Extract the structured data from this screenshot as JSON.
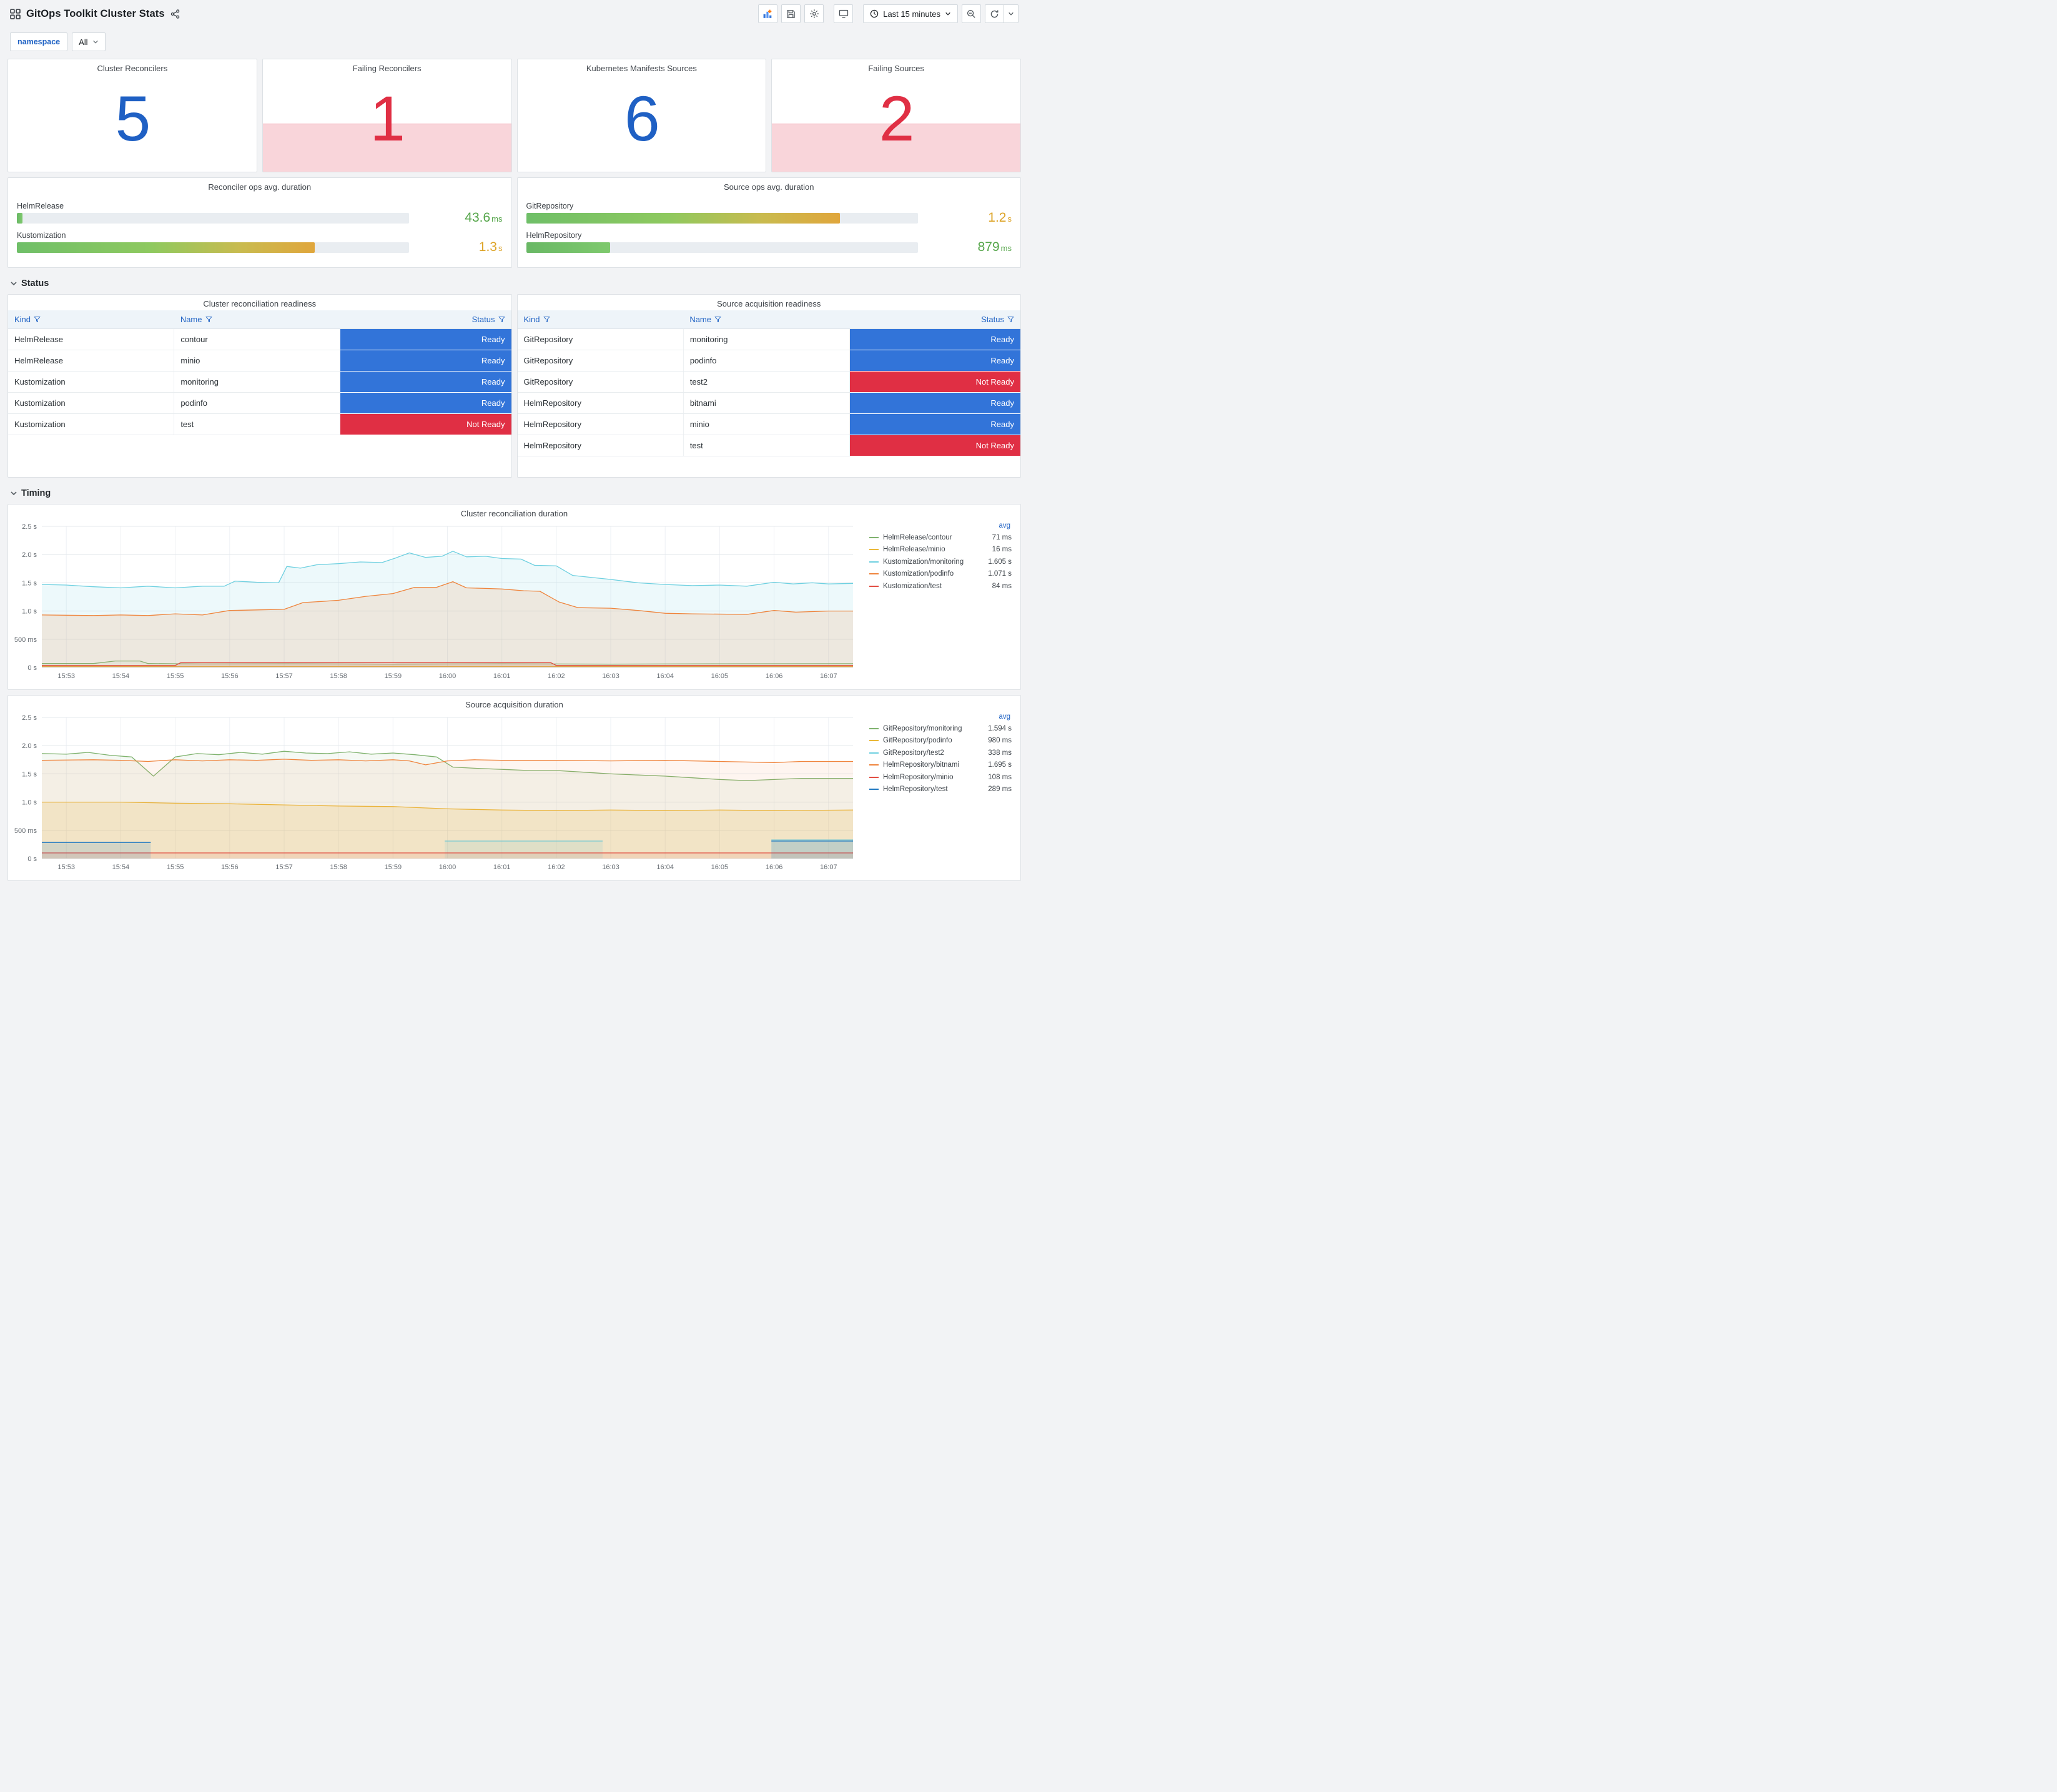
{
  "header": {
    "title": "GitOps Toolkit Cluster Stats",
    "time_range": "Last 15 minutes"
  },
  "variables": {
    "label": "namespace",
    "value": "All"
  },
  "colors": {
    "stat_ok": "#1f60c4",
    "stat_alert": "#e02f44",
    "ready": "#3274d9",
    "not_ready": "#e02f44",
    "value_green": "#56a64b",
    "value_yellow": "#dda428",
    "link_blue": "#1f62c4"
  },
  "icons": {
    "apps": "grid-4-squares",
    "share": "share-nodes",
    "add_panel": "panel-plus",
    "save": "floppy-disk",
    "settings": "gear",
    "tv_mode": "monitor",
    "clock": "clock",
    "caret": "chevron-down",
    "zoom_out": "magnifier-minus",
    "refresh": "circular-arrow",
    "filter": "funnel",
    "section_toggle": "chevron-down"
  },
  "stats": [
    {
      "title": "Cluster Reconcilers",
      "value": "5",
      "state": "ok"
    },
    {
      "title": "Failing Reconcilers",
      "value": "1",
      "state": "alert"
    },
    {
      "title": "Kubernetes Manifests Sources",
      "value": "6",
      "state": "ok"
    },
    {
      "title": "Failing Sources",
      "value": "2",
      "state": "alert"
    }
  ],
  "gauges": [
    {
      "title": "Reconciler ops avg. duration",
      "rows": [
        {
          "label": "HelmRelease",
          "value": "43.6",
          "unit": "ms",
          "pct": 1.5,
          "bar_class": "bar-green",
          "val_class": "green"
        },
        {
          "label": "Kustomization",
          "value": "1.3",
          "unit": "s",
          "pct": 76,
          "bar_class": "bar-grad",
          "val_class": "yellow"
        }
      ]
    },
    {
      "title": "Source ops avg. duration",
      "rows": [
        {
          "label": "GitRepository",
          "value": "1.2",
          "unit": "s",
          "pct": 80,
          "bar_class": "bar-grad",
          "val_class": "yellow"
        },
        {
          "label": "HelmRepository",
          "value": "879",
          "unit": "ms",
          "pct": 21.5,
          "bar_class": "bar-green",
          "val_class": "green"
        }
      ]
    }
  ],
  "sections": {
    "status": "Status",
    "timing": "Timing"
  },
  "tables": [
    {
      "title": "Cluster reconciliation readiness",
      "columns": [
        "Kind",
        "Name",
        "Status"
      ],
      "rows": [
        [
          "HelmRelease",
          "contour",
          "Ready"
        ],
        [
          "HelmRelease",
          "minio",
          "Ready"
        ],
        [
          "Kustomization",
          "monitoring",
          "Ready"
        ],
        [
          "Kustomization",
          "podinfo",
          "Ready"
        ],
        [
          "Kustomization",
          "test",
          "Not Ready"
        ]
      ]
    },
    {
      "title": "Source acquisition readiness",
      "columns": [
        "Kind",
        "Name",
        "Status"
      ],
      "rows": [
        [
          "GitRepository",
          "monitoring",
          "Ready"
        ],
        [
          "GitRepository",
          "podinfo",
          "Ready"
        ],
        [
          "GitRepository",
          "test2",
          "Not Ready"
        ],
        [
          "HelmRepository",
          "bitnami",
          "Ready"
        ],
        [
          "HelmRepository",
          "minio",
          "Ready"
        ],
        [
          "HelmRepository",
          "test",
          "Not Ready"
        ]
      ]
    }
  ],
  "chart_data": [
    {
      "type": "line",
      "title": "Cluster reconciliation duration",
      "legend_header": "avg",
      "xlabel": "",
      "ylabel": "",
      "ylim": [
        0,
        2.5
      ],
      "xlim": [
        -0.45,
        14.45
      ],
      "y_ticks": [
        "0 s",
        "500 ms",
        "1.0 s",
        "1.5 s",
        "2.0 s",
        "2.5 s"
      ],
      "x_ticks": [
        "15:53",
        "15:54",
        "15:55",
        "15:56",
        "15:57",
        "15:58",
        "15:59",
        "16:00",
        "16:01",
        "16:02",
        "16:03",
        "16:04",
        "16:05",
        "16:06",
        "16:07"
      ],
      "series": [
        {
          "name": "HelmRelease/contour",
          "avg": "71 ms",
          "color": "#7eb26d",
          "fill": 0.08,
          "points": [
            [
              -0.45,
              0.07
            ],
            [
              0.5,
              0.07
            ],
            [
              0.9,
              0.115
            ],
            [
              1.35,
              0.115
            ],
            [
              1.5,
              0.07
            ],
            [
              2.5,
              0.062
            ],
            [
              4,
              0.065
            ],
            [
              6,
              0.06
            ],
            [
              8,
              0.065
            ],
            [
              10,
              0.06
            ],
            [
              12,
              0.065
            ],
            [
              14.45,
              0.068
            ]
          ]
        },
        {
          "name": "HelmRelease/minio",
          "avg": "16 ms",
          "color": "#eab839",
          "fill": 0.08,
          "points": [
            [
              -0.45,
              0.018
            ],
            [
              14.45,
              0.018
            ]
          ]
        },
        {
          "name": "Kustomization/monitoring",
          "avg": "1.605 s",
          "color": "#6ed0e0",
          "fill": 0.12,
          "points": [
            [
              -0.45,
              1.47
            ],
            [
              0,
              1.46
            ],
            [
              0.5,
              1.43
            ],
            [
              1,
              1.41
            ],
            [
              1.5,
              1.44
            ],
            [
              2,
              1.41
            ],
            [
              2.5,
              1.44
            ],
            [
              2.9,
              1.44
            ],
            [
              3.1,
              1.53
            ],
            [
              3.5,
              1.51
            ],
            [
              3.9,
              1.5
            ],
            [
              4.05,
              1.79
            ],
            [
              4.3,
              1.76
            ],
            [
              4.6,
              1.82
            ],
            [
              5,
              1.84
            ],
            [
              5.4,
              1.87
            ],
            [
              5.8,
              1.86
            ],
            [
              6.05,
              1.94
            ],
            [
              6.3,
              2.03
            ],
            [
              6.6,
              1.95
            ],
            [
              6.9,
              1.97
            ],
            [
              7.1,
              2.06
            ],
            [
              7.35,
              1.96
            ],
            [
              7.7,
              1.97
            ],
            [
              8,
              1.93
            ],
            [
              8.35,
              1.92
            ],
            [
              8.6,
              1.81
            ],
            [
              9,
              1.8
            ],
            [
              9.3,
              1.63
            ],
            [
              9.6,
              1.6
            ],
            [
              10,
              1.56
            ],
            [
              10.5,
              1.5
            ],
            [
              11,
              1.47
            ],
            [
              11.5,
              1.45
            ],
            [
              12,
              1.46
            ],
            [
              12.5,
              1.44
            ],
            [
              13,
              1.51
            ],
            [
              13.35,
              1.48
            ],
            [
              13.7,
              1.5
            ],
            [
              14,
              1.48
            ],
            [
              14.45,
              1.49
            ]
          ]
        },
        {
          "name": "Kustomization/podinfo",
          "avg": "1.071 s",
          "color": "#ef843c",
          "fill": 0.14,
          "points": [
            [
              -0.45,
              0.93
            ],
            [
              0.5,
              0.92
            ],
            [
              1,
              0.93
            ],
            [
              1.5,
              0.92
            ],
            [
              2,
              0.95
            ],
            [
              2.5,
              0.93
            ],
            [
              3,
              1.01
            ],
            [
              3.5,
              1.02
            ],
            [
              4,
              1.03
            ],
            [
              4.35,
              1.15
            ],
            [
              4.7,
              1.17
            ],
            [
              5,
              1.19
            ],
            [
              5.5,
              1.26
            ],
            [
              6,
              1.31
            ],
            [
              6.4,
              1.42
            ],
            [
              6.8,
              1.42
            ],
            [
              7.1,
              1.52
            ],
            [
              7.35,
              1.41
            ],
            [
              7.7,
              1.4
            ],
            [
              8,
              1.39
            ],
            [
              8.4,
              1.36
            ],
            [
              8.7,
              1.35
            ],
            [
              9.05,
              1.16
            ],
            [
              9.4,
              1.06
            ],
            [
              10,
              1.05
            ],
            [
              10.5,
              1.01
            ],
            [
              11,
              0.96
            ],
            [
              11.5,
              0.95
            ],
            [
              12.5,
              0.94
            ],
            [
              13,
              1.01
            ],
            [
              13.4,
              0.98
            ],
            [
              14,
              1.0
            ],
            [
              14.45,
              1.0
            ]
          ]
        },
        {
          "name": "Kustomization/test",
          "avg": "84 ms",
          "color": "#e24d42",
          "fill": 0.12,
          "points": [
            [
              -0.45,
              0.035
            ],
            [
              2.0,
              0.035
            ],
            [
              2.1,
              0.085
            ],
            [
              8.9,
              0.085
            ],
            [
              9.0,
              0.035
            ],
            [
              14.45,
              0.035
            ]
          ]
        }
      ]
    },
    {
      "type": "line",
      "title": "Source acquisition duration",
      "legend_header": "avg",
      "xlabel": "",
      "ylabel": "",
      "ylim": [
        0,
        2.5
      ],
      "xlim": [
        -0.45,
        14.45
      ],
      "y_ticks": [
        "0 s",
        "500 ms",
        "1.0 s",
        "1.5 s",
        "2.0 s",
        "2.5 s"
      ],
      "x_ticks": [
        "15:53",
        "15:54",
        "15:55",
        "15:56",
        "15:57",
        "15:58",
        "15:59",
        "16:00",
        "16:01",
        "16:02",
        "16:03",
        "16:04",
        "16:05",
        "16:06",
        "16:07"
      ],
      "series": [
        {
          "name": "GitRepository/monitoring",
          "avg": "1.594 s",
          "color": "#7eb26d",
          "fill": 0.08,
          "points": [
            [
              -0.45,
              1.86
            ],
            [
              0,
              1.85
            ],
            [
              0.4,
              1.88
            ],
            [
              0.8,
              1.83
            ],
            [
              1.2,
              1.8
            ],
            [
              1.6,
              1.46
            ],
            [
              2,
              1.8
            ],
            [
              2.4,
              1.86
            ],
            [
              2.8,
              1.84
            ],
            [
              3.2,
              1.88
            ],
            [
              3.6,
              1.85
            ],
            [
              4,
              1.9
            ],
            [
              4.4,
              1.87
            ],
            [
              4.8,
              1.86
            ],
            [
              5.2,
              1.89
            ],
            [
              5.6,
              1.85
            ],
            [
              6,
              1.87
            ],
            [
              6.4,
              1.84
            ],
            [
              6.8,
              1.8
            ],
            [
              7.1,
              1.62
            ],
            [
              7.5,
              1.6
            ],
            [
              8,
              1.58
            ],
            [
              8.5,
              1.56
            ],
            [
              9,
              1.56
            ],
            [
              9.5,
              1.53
            ],
            [
              10,
              1.5
            ],
            [
              10.5,
              1.48
            ],
            [
              11,
              1.46
            ],
            [
              11.5,
              1.43
            ],
            [
              12,
              1.4
            ],
            [
              12.5,
              1.38
            ],
            [
              13,
              1.4
            ],
            [
              13.5,
              1.42
            ],
            [
              14,
              1.42
            ],
            [
              14.45,
              1.42
            ]
          ]
        },
        {
          "name": "GitRepository/podinfo",
          "avg": "980 ms",
          "color": "#eab839",
          "fill": 0.18,
          "points": [
            [
              -0.45,
              1.0
            ],
            [
              1,
              1.0
            ],
            [
              2,
              0.98
            ],
            [
              3,
              0.97
            ],
            [
              4,
              0.95
            ],
            [
              5,
              0.93
            ],
            [
              6,
              0.92
            ],
            [
              6.5,
              0.9
            ],
            [
              7,
              0.88
            ],
            [
              8,
              0.86
            ],
            [
              9,
              0.85
            ],
            [
              10,
              0.86
            ],
            [
              11,
              0.85
            ],
            [
              12,
              0.86
            ],
            [
              13,
              0.85
            ],
            [
              14.45,
              0.86
            ]
          ]
        },
        {
          "name": "GitRepository/test2",
          "avg": "338 ms",
          "color": "#6ed0e0",
          "fill": 0.15,
          "points": [
            [
              6.95,
              0.31
            ],
            [
              9.85,
              0.31
            ],
            [
              9.9,
              null
            ],
            [
              12.95,
              0.33
            ],
            [
              14.45,
              0.33
            ]
          ]
        },
        {
          "name": "HelmRepository/bitnami",
          "avg": "1.695 s",
          "color": "#ef843c",
          "fill": 0.08,
          "points": [
            [
              -0.45,
              1.74
            ],
            [
              0.5,
              1.75
            ],
            [
              1,
              1.74
            ],
            [
              1.5,
              1.72
            ],
            [
              2,
              1.75
            ],
            [
              2.5,
              1.73
            ],
            [
              3,
              1.75
            ],
            [
              3.5,
              1.74
            ],
            [
              4,
              1.76
            ],
            [
              4.5,
              1.74
            ],
            [
              5,
              1.75
            ],
            [
              5.5,
              1.73
            ],
            [
              6,
              1.75
            ],
            [
              6.3,
              1.73
            ],
            [
              6.6,
              1.66
            ],
            [
              7,
              1.73
            ],
            [
              7.5,
              1.75
            ],
            [
              8,
              1.74
            ],
            [
              9,
              1.74
            ],
            [
              10,
              1.73
            ],
            [
              11,
              1.74
            ],
            [
              12,
              1.72
            ],
            [
              13,
              1.7
            ],
            [
              13.5,
              1.72
            ],
            [
              14.45,
              1.72
            ]
          ]
        },
        {
          "name": "HelmRepository/minio",
          "avg": "108 ms",
          "color": "#e24d42",
          "fill": 0.1,
          "points": [
            [
              -0.45,
              0.1
            ],
            [
              14.45,
              0.1
            ]
          ]
        },
        {
          "name": "HelmRepository/test",
          "avg": "289 ms",
          "color": "#1f78c1",
          "fill": 0.15,
          "points": [
            [
              -0.45,
              0.285
            ],
            [
              1.55,
              0.285
            ],
            [
              1.6,
              null
            ],
            [
              12.95,
              0.31
            ],
            [
              14.45,
              0.31
            ]
          ]
        }
      ]
    }
  ]
}
